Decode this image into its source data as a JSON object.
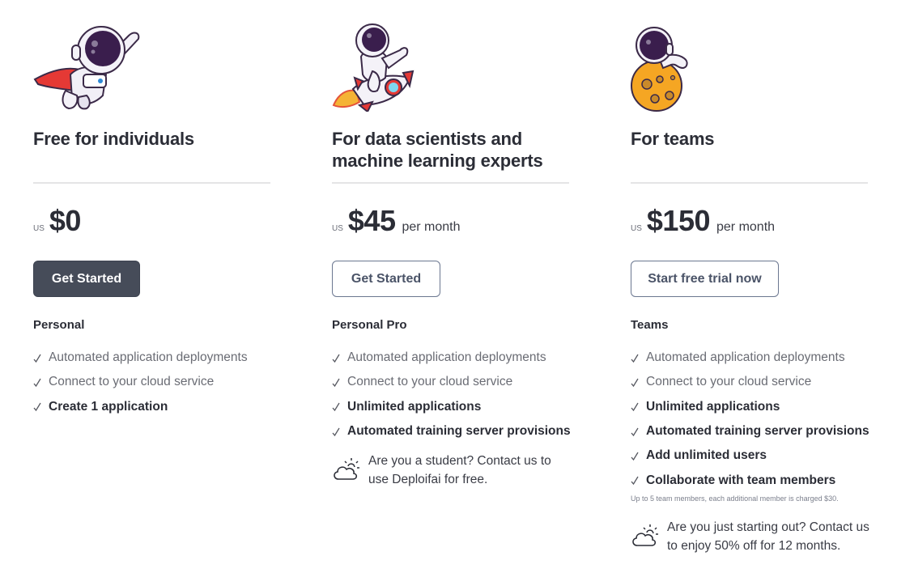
{
  "tiers": [
    {
      "illustration": "astronaut-flying-with-cape",
      "title": "Free for individuals",
      "currency": "US",
      "price": "$0",
      "period": "",
      "button": {
        "label": "Get Started",
        "style": "solid"
      },
      "plan_name": "Personal",
      "features": [
        {
          "icon": "check-icon",
          "text": "Automated application deployments",
          "emphasis": false
        },
        {
          "icon": "check-icon",
          "text": "Connect to your cloud service",
          "emphasis": false
        },
        {
          "icon": "check-icon",
          "text": "Create 1 application",
          "emphasis": true
        }
      ]
    },
    {
      "illustration": "astronaut-riding-rocket",
      "title": "For data scientists and machine learning experts",
      "currency": "US",
      "price": "$45",
      "period": "per month",
      "button": {
        "label": "Get Started",
        "style": "outline"
      },
      "plan_name": "Personal Pro",
      "features": [
        {
          "icon": "check-icon",
          "text": "Automated application deployments",
          "emphasis": false
        },
        {
          "icon": "check-icon",
          "text": "Connect to your cloud service",
          "emphasis": false
        },
        {
          "icon": "check-icon",
          "text": "Unlimited applications",
          "emphasis": true
        },
        {
          "icon": "check-icon",
          "text": "Automated training server provisions",
          "emphasis": true
        }
      ],
      "note": {
        "icon": "cloud-sun-icon",
        "text": "Are you a student? Contact us to use Deploifai for free."
      }
    },
    {
      "illustration": "astronaut-on-moon",
      "title": "For teams",
      "currency": "US",
      "price": "$150",
      "period": "per month",
      "button": {
        "label": "Start free trial now",
        "style": "outline"
      },
      "plan_name": "Teams",
      "features": [
        {
          "icon": "check-icon",
          "text": "Automated application deployments",
          "emphasis": false
        },
        {
          "icon": "check-icon",
          "text": "Connect to your cloud service",
          "emphasis": false
        },
        {
          "icon": "check-icon",
          "text": "Unlimited applications",
          "emphasis": true
        },
        {
          "icon": "check-icon",
          "text": "Automated training server provisions",
          "emphasis": true
        },
        {
          "icon": "check-icon",
          "text": "Add unlimited users",
          "emphasis": true
        },
        {
          "icon": "check-icon",
          "text": "Collaborate with team members",
          "emphasis": true
        }
      ],
      "fine_print": "Up to 5 team members, each additional member is charged $30.",
      "note": {
        "icon": "cloud-sun-icon",
        "text": "Are you just starting out? Contact us to enjoy 50% off for 12 months."
      }
    }
  ],
  "colors": {
    "heading": "#2b2d36",
    "muted_text": "#6a6c74",
    "solid_button_bg": "#464c59",
    "outline_button_border": "#6b7790",
    "divider": "#e4e4e6"
  }
}
